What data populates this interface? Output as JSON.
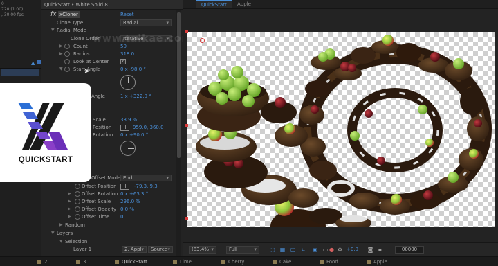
{
  "project_panel": {
    "line1": "0",
    "line2": "720 (1.00)",
    "line3": ", 30.00 fps"
  },
  "effect_controls": {
    "header": "QuickStart • White Solid 8",
    "fx_label": "fx",
    "effect_name": "xCloner",
    "reset_label": "Reset",
    "properties": [
      {
        "label": "Clone Type",
        "value": "Radial"
      },
      {
        "label": "Radial Mode"
      },
      {
        "label": "Clone Order",
        "value": "Iterative"
      },
      {
        "label": "Count",
        "value": "50"
      },
      {
        "label": "Radius",
        "value": "318.0"
      },
      {
        "label": "Look at Center",
        "value": "checked"
      },
      {
        "label": "Start Angle",
        "value": "0 x -98.0 °"
      },
      {
        "label": "Angle",
        "value": "1 x +322.0 °"
      },
      {
        "label": "Scale",
        "value": "33.9 %"
      },
      {
        "label": "Position",
        "value": "959.0, 360.0"
      },
      {
        "label": "Rotation",
        "value": "0 x +90.0 °"
      },
      {
        "label": "Offset Mode",
        "value": "End"
      },
      {
        "label": "Offset Position",
        "value": "-79.3, 9.3"
      },
      {
        "label": "Offset Rotation",
        "value": "0 x +63.3 °"
      },
      {
        "label": "Offset Scale",
        "value": "296.0 %"
      },
      {
        "label": "Offset Opacity",
        "value": "0.0 %"
      },
      {
        "label": "Offset Time",
        "value": "0"
      },
      {
        "label": "Random"
      },
      {
        "label": "Layers"
      },
      {
        "label": "Selection"
      },
      {
        "label": "Layer 1",
        "layer_value": "2. Appl",
        "source_value": "Source"
      }
    ]
  },
  "watermark": "www.talkae.com",
  "logo": {
    "text": "QUICKSTART",
    "colors": [
      "#2b6fd6",
      "#5b4fd0",
      "#8a3fc8",
      "#1a1a1a"
    ]
  },
  "comp_tabs": [
    {
      "label": "QuickStart",
      "active": true
    },
    {
      "label": "Apple",
      "active": false
    }
  ],
  "viewer_bar": {
    "zoom": "(83.4%)",
    "resolution": "Full",
    "exposure": "+0.0",
    "timecode": "00000",
    "icons": [
      "region-icon",
      "transparency-grid-icon",
      "mask-icon",
      "crop-icon",
      "guides-icon",
      "channel-icon",
      "exposure-reset-icon",
      "camera-icon",
      "show-snapshot-icon"
    ]
  },
  "timeline_tabs": [
    {
      "label": "2",
      "active": false
    },
    {
      "label": "3",
      "active": false
    },
    {
      "label": "QuickStart",
      "active": true
    },
    {
      "label": "Lime",
      "active": false
    },
    {
      "label": "Cherry",
      "active": false
    },
    {
      "label": "Cake",
      "active": false
    },
    {
      "label": "Food",
      "active": false
    },
    {
      "label": "Apple",
      "active": false
    }
  ]
}
